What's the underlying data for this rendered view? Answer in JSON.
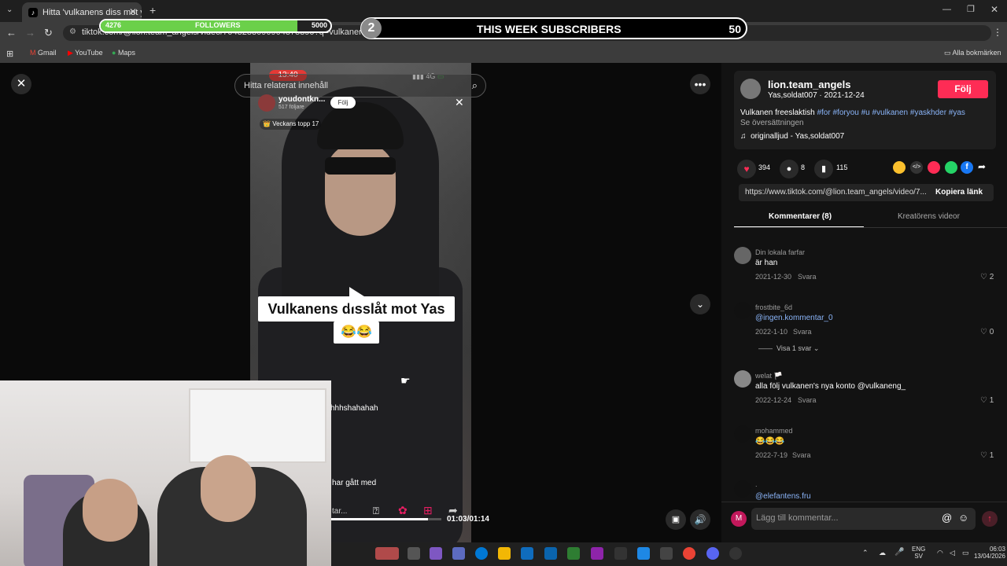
{
  "browser": {
    "tab_title": "Hitta 'vulkanens diss mot yas' p",
    "url": "tiktok.com/@lion.team_angels/video/7043283090904375390?q=vulkanens%20diss%20mot%20yas&t=1776052830613",
    "bookmarks": [
      "Gmail",
      "YouTube",
      "Maps"
    ],
    "all_bookmarks": "Alla bokmärken"
  },
  "overlay": {
    "followers_current": "4276",
    "followers_label": "FOLLOWERS",
    "followers_goal": "5000",
    "followers_progress": 0.855,
    "subs_rank": "2",
    "subs_label": "THIS WEEK SUBSCRIBERS",
    "subs_value": "50"
  },
  "video": {
    "search_placeholder": "Hitta relaterat innehåll",
    "inner_time": "13:40",
    "inner_signal": "4G",
    "inner_user": "youdontkn...",
    "inner_followers": "517 följare",
    "inner_follow": "Följ",
    "inner_badge": "Veckans topp 17",
    "caption": "Vulkanens disslåt mot Yas",
    "caption_emoji": "😂😂",
    "inner_comment": "hhhshahahah",
    "inner_text2": "har gått med",
    "inner_write": "tar...",
    "time_current": "01:03",
    "time_total": "01:14",
    "progress": 0.88
  },
  "panel": {
    "author": "lion.team_angels",
    "author_sub": "Yas,soldat007 · 2021-12-24",
    "follow": "Följ",
    "desc": "Vulkanen freeslaktish",
    "tags": "#for #foryou #u #vulkanen #yaskhder #yas",
    "translate": "Se översättningen",
    "sound": "originalljud - Yas,soldat007",
    "likes": "394",
    "comments": "8",
    "saves": "115",
    "share_url": "https://www.tiktok.com/@lion.team_angels/video/7...",
    "copy_link": "Kopiera länk",
    "tab_comments": "Kommentarer (8)",
    "tab_creator": "Kreatörens videor",
    "comment_list": [
      {
        "user": "Din lokala farfar",
        "text": "är han",
        "date": "2021-12-30",
        "reply": "Svara",
        "likes": "2"
      },
      {
        "user": "frostbite_6d",
        "text": "@ingen.kommentar_0",
        "date": "2022-1-10",
        "reply": "Svara",
        "likes": "0"
      },
      {
        "user": "welat 🏳️",
        "text": "alla följ vulkanen's nya konto @vulkaneng_",
        "date": "2022-12-24",
        "reply": "Svara",
        "likes": "1"
      },
      {
        "user": "mohammed",
        "text": "😂😂😂",
        "date": "2022-7-19",
        "reply": "Svara",
        "likes": "1"
      },
      {
        "user": ".",
        "text": "@elefantens.fru",
        "date": "",
        "reply": "",
        "likes": ""
      }
    ],
    "show_replies": "Visa 1 svar",
    "add_comment": "Lägg till kommentar..."
  },
  "taskbar": {
    "lang": "ENG",
    "lang2": "SV",
    "time": "06:03",
    "date": "13/04/2026"
  }
}
